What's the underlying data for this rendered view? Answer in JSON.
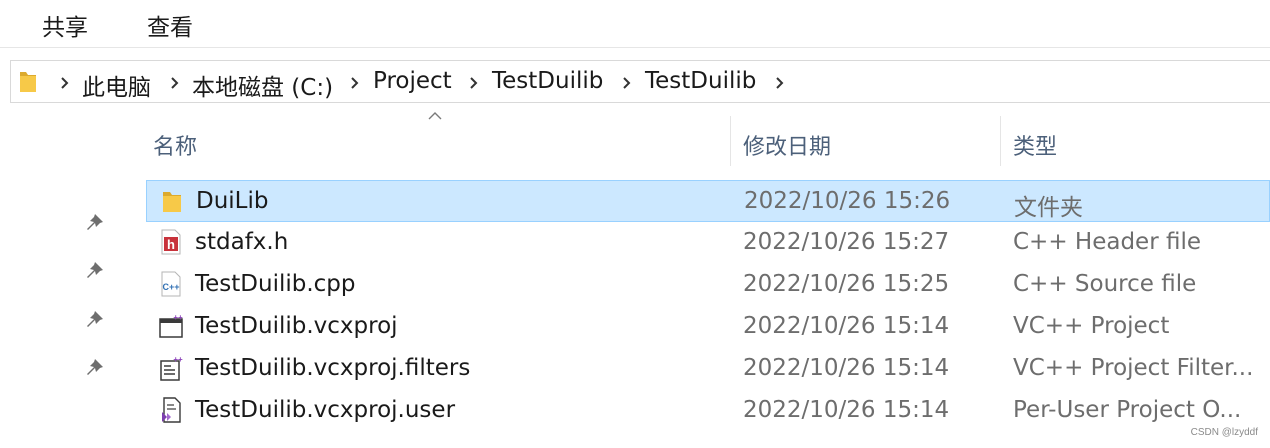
{
  "ribbon": {
    "tabs": [
      "共享",
      "查看"
    ]
  },
  "address": {
    "crumbs": [
      "此电脑",
      "本地磁盘 (C:)",
      "Project",
      "TestDuilib",
      "TestDuilib"
    ]
  },
  "columns": {
    "name": "名称",
    "date": "修改日期",
    "type": "类型"
  },
  "files": [
    {
      "name": "DuiLib",
      "date": "2022/10/26 15:26",
      "type": "文件夹",
      "icon": "folder-icon",
      "selected": true
    },
    {
      "name": "stdafx.h",
      "date": "2022/10/26 15:27",
      "type": "C++ Header file",
      "icon": "header-file-icon",
      "selected": false
    },
    {
      "name": "TestDuilib.cpp",
      "date": "2022/10/26 15:25",
      "type": "C++ Source file",
      "icon": "cpp-file-icon",
      "selected": false
    },
    {
      "name": "TestDuilib.vcxproj",
      "date": "2022/10/26 15:14",
      "type": "VC++ Project",
      "icon": "vcxproj-file-icon",
      "selected": false
    },
    {
      "name": "TestDuilib.vcxproj.filters",
      "date": "2022/10/26 15:14",
      "type": "VC++ Project Filter...",
      "icon": "filters-file-icon",
      "selected": false
    },
    {
      "name": "TestDuilib.vcxproj.user",
      "date": "2022/10/26 15:14",
      "type": "Per-User Project O...",
      "icon": "user-file-icon",
      "selected": false
    }
  ],
  "colors": {
    "selection": "#cce8ff",
    "selection_border": "#99d1ff",
    "header_text": "#4c607a",
    "secondary_text": "#6d6d6d",
    "folder": "#f7c948"
  },
  "watermark": "CSDN @lzyddf"
}
